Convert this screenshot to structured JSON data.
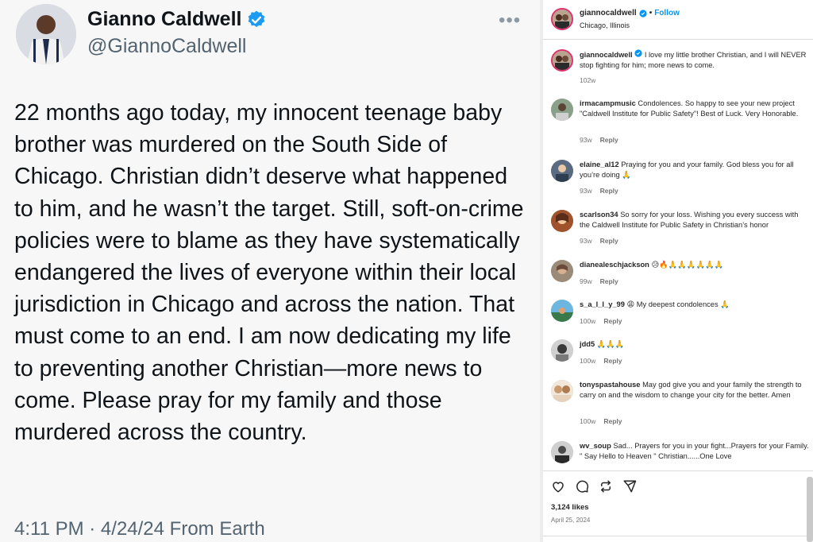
{
  "tweet": {
    "name": "Gianno Caldwell",
    "handle": "@GiannoCaldwell",
    "text": "22 months ago today, my innocent teenage baby brother was murdered on the South Side of Chicago. Christian didn’t deserve what happened to him, and he wasn’t the target. Still, soft-on-crime policies were to blame as they have systematically endangered the lives of everyone within their local jurisdiction in Chicago and across the nation. That must come to an end. I am now dedicating my life to preventing another Christian—more news to come. Please pray for my family and those murdered across the country.",
    "meta": "4:11 PM · 4/24/24 From Earth",
    "more_icon": "ellipsis-icon",
    "verified_color": "#1d9bf0"
  },
  "instagram": {
    "header": {
      "username": "giannocaldwell",
      "separator": "•",
      "follow_label": "Follow",
      "location": "Chicago, Illinois"
    },
    "caption": {
      "username": "giannocaldwell",
      "text": "I love my little brother Christian, and I will NEVER stop fighting for him; more news to come.",
      "time": "102w"
    },
    "reply_label": "Reply",
    "comments": [
      {
        "username": "irmacampmusic",
        "text": "Condolences. So happy to see your new project \"Caldwell Institute for Public Safety\"! Best of Luck. Very Honorable.",
        "time": "93w"
      },
      {
        "username": "elaine_al12",
        "text": "Praying for you and your family. God bless you for all you’re doing 🙏",
        "time": "93w"
      },
      {
        "username": "scarlson34",
        "text": "So sorry for your loss. Wishing you every success with the Caldwell Institute for Public Safety in Christian’s honor",
        "time": "93w"
      },
      {
        "username": "dianealeschjackson",
        "text": "😥🔥🙏🙏🙏🙏🙏🙏",
        "time": "99w"
      },
      {
        "username": "s_a_l_l_y_99",
        "text": "😩 My deepest condolences 🙏",
        "time": "100w"
      },
      {
        "username": "jdd5",
        "text": "🙏🙏🙏",
        "time": "100w"
      },
      {
        "username": "tonyspastahouse",
        "text": "May god give you and your family the strength to carry on and the wisdom to change your city for the better. Amen",
        "time": "100w"
      },
      {
        "username": "wv_soup",
        "text": "Sad... Prayers for you in your fight...Prayers for your Family. \" Say Hello to Heaven \" Christian......One Love",
        "time": ""
      }
    ],
    "likes": "3,124 likes",
    "date": "April 25, 2024",
    "icons": [
      "heart-icon",
      "comment-icon",
      "repost-icon",
      "share-icon"
    ],
    "colors": {
      "follow": "#0095f6",
      "verified": "#0095f6",
      "text": "#262626",
      "muted": "#737373"
    }
  }
}
